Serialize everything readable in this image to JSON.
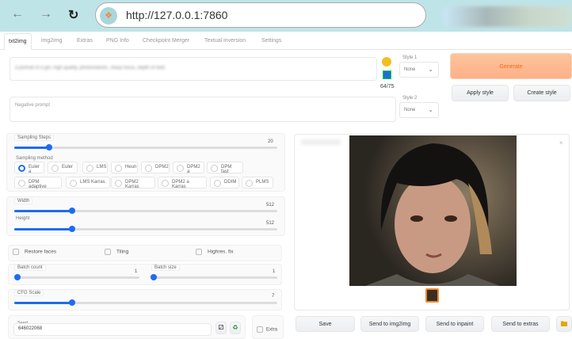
{
  "browser": {
    "back_icon": "arrow-left",
    "forward_icon": "arrow-right",
    "reload_icon": "reload",
    "url": "http://127.0.0.1:7860"
  },
  "tabs": [
    "txt2img",
    "img2img",
    "Extras",
    "PNG Info",
    "Checkpoint Merger",
    "Textual inversion",
    "Settings"
  ],
  "prompt": {
    "value": "a portrait of a girl, high quality, photorealistic, sharp focus, depth of field",
    "token_count": "64/75",
    "negative_placeholder": "Negative prompt"
  },
  "styles": {
    "style1_label": "Style 1",
    "style1_value": "None",
    "style2_label": "Style 2",
    "style2_value": "None"
  },
  "buttons": {
    "generate": "Generate",
    "apply_style": "Apply style",
    "create_style": "Create style",
    "save": "Save",
    "send_img2img": "Send to img2img",
    "send_inpaint": "Send to inpaint",
    "send_extras": "Send to extras"
  },
  "sampling": {
    "steps_label": "Sampling Steps",
    "steps_value": "20",
    "steps_fraction": 0.133,
    "method_label": "Sampling method",
    "methods": [
      "Euler a",
      "Euler",
      "LMS",
      "Heun",
      "DPM2",
      "DPM2 a",
      "DPM fast",
      "DPM adaptive",
      "LMS Karras",
      "DPM2 Karras",
      "DPM2 a Karras",
      "DDIM",
      "PLMS"
    ],
    "selected": "Euler a"
  },
  "size": {
    "width_label": "Width",
    "width_value": "512",
    "width_fraction": 0.22,
    "height_label": "Height",
    "height_value": "512",
    "height_fraction": 0.22
  },
  "options": {
    "restore_faces": "Restore faces",
    "tiling": "Tiling",
    "highres_fix": "Highres. fix"
  },
  "batch": {
    "count_label": "Batch count",
    "count_value": "1",
    "size_label": "Batch size",
    "size_value": "1"
  },
  "cfg": {
    "label": "CFG Scale",
    "value": "7",
    "fraction": 0.22
  },
  "seed": {
    "label": "Seed",
    "value": "646022068",
    "extra_label": "Extra"
  },
  "colors": {
    "accent": "#1d6cf0",
    "generate": "#fdb88a"
  }
}
